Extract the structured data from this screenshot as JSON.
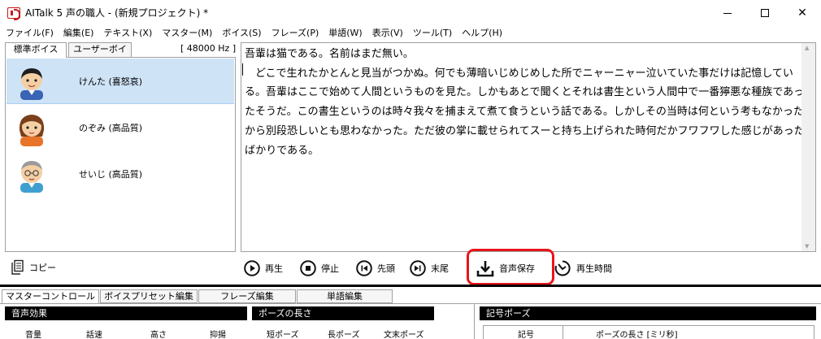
{
  "window": {
    "title": "AITalk 5 声の職人 - (新規プロジェクト) *",
    "controls": {
      "minimize": "minimize",
      "maximize": "maximize",
      "close": "✕"
    }
  },
  "menu": [
    "ファイル(F)",
    "編集(E)",
    "テキスト(X)",
    "マスター(M)",
    "ボイス(S)",
    "フレーズ(P)",
    "単語(W)",
    "表示(V)",
    "ツール(T)",
    "ヘルプ(H)"
  ],
  "voice_panel": {
    "tabs": [
      "標準ボイス",
      "ユーザーボイス"
    ],
    "sample_rate": "[ 48000 Hz ]",
    "voices": [
      {
        "name": "けんた (喜怒哀)",
        "selected": true,
        "avatar_icon": "boy-avatar-icon"
      },
      {
        "name": "のぞみ (高品質)",
        "selected": false,
        "avatar_icon": "girl-avatar-icon"
      },
      {
        "name": "せいじ (高品質)",
        "selected": false,
        "avatar_icon": "man-glasses-avatar-icon"
      }
    ],
    "copy_label": "コピー"
  },
  "editor": {
    "text": "吾輩は猫である。名前はまだ無い。\n　どこで生れたかとんと見当がつかぬ。何でも薄暗いじめじめした所でニャーニャー泣いていた事だけは記憶している。吾輩はここで始めて人間というものを見た。しかもあとで聞くとそれは書生という人間中で一番獰悪な種族であったそうだ。この書生というのは時々我々を捕まえて煮て食うという話である。しかしその当時は何という考もなかったから別段恐しいとも思わなかった。ただ彼の掌に載せられてスーと持ち上げられた時何だかフワフワした感じがあったばかりである。"
  },
  "controls": {
    "play": "再生",
    "stop": "停止",
    "head": "先頭",
    "end": "末尾",
    "save_audio": "音声保存",
    "play_time": "再生時間"
  },
  "bottom_tabs": [
    "マスターコントロール",
    "ボイスプリセット編集",
    "フレーズ編集",
    "単語編集"
  ],
  "sections": {
    "effects": {
      "title": "音声効果",
      "columns": [
        "音量",
        "話速",
        "高さ",
        "抑揚"
      ]
    },
    "pause": {
      "title": "ポーズの長さ",
      "columns": [
        "短ポーズ",
        "長ポーズ",
        "文末ポーズ"
      ]
    },
    "symbol_pause": {
      "title": "記号ポーズ",
      "columns": [
        "記号",
        "ポーズの長さ [ミリ秒]"
      ]
    }
  },
  "colors": {
    "selection": "#cfe3f7",
    "highlight": "#e8141a",
    "header_bg": "#000000"
  }
}
